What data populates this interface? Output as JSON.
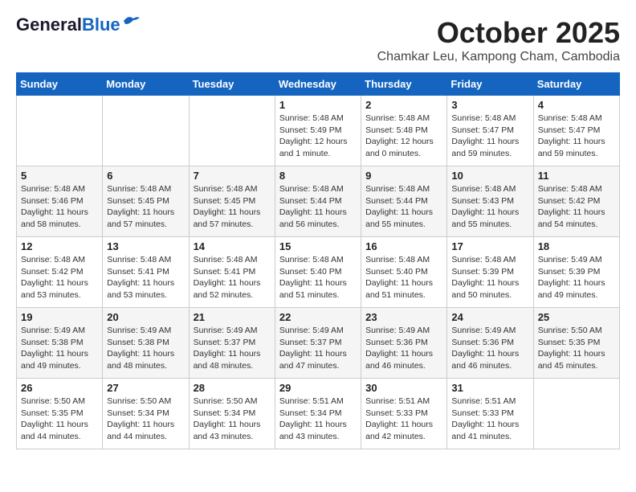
{
  "logo": {
    "line1": "General",
    "line2": "Blue"
  },
  "title": "October 2025",
  "location": "Chamkar Leu, Kampong Cham, Cambodia",
  "days_of_week": [
    "Sunday",
    "Monday",
    "Tuesday",
    "Wednesday",
    "Thursday",
    "Friday",
    "Saturday"
  ],
  "weeks": [
    [
      {
        "day": "",
        "info": ""
      },
      {
        "day": "",
        "info": ""
      },
      {
        "day": "",
        "info": ""
      },
      {
        "day": "1",
        "info": "Sunrise: 5:48 AM\nSunset: 5:49 PM\nDaylight: 12 hours\nand 1 minute."
      },
      {
        "day": "2",
        "info": "Sunrise: 5:48 AM\nSunset: 5:48 PM\nDaylight: 12 hours\nand 0 minutes."
      },
      {
        "day": "3",
        "info": "Sunrise: 5:48 AM\nSunset: 5:47 PM\nDaylight: 11 hours\nand 59 minutes."
      },
      {
        "day": "4",
        "info": "Sunrise: 5:48 AM\nSunset: 5:47 PM\nDaylight: 11 hours\nand 59 minutes."
      }
    ],
    [
      {
        "day": "5",
        "info": "Sunrise: 5:48 AM\nSunset: 5:46 PM\nDaylight: 11 hours\nand 58 minutes."
      },
      {
        "day": "6",
        "info": "Sunrise: 5:48 AM\nSunset: 5:45 PM\nDaylight: 11 hours\nand 57 minutes."
      },
      {
        "day": "7",
        "info": "Sunrise: 5:48 AM\nSunset: 5:45 PM\nDaylight: 11 hours\nand 57 minutes."
      },
      {
        "day": "8",
        "info": "Sunrise: 5:48 AM\nSunset: 5:44 PM\nDaylight: 11 hours\nand 56 minutes."
      },
      {
        "day": "9",
        "info": "Sunrise: 5:48 AM\nSunset: 5:44 PM\nDaylight: 11 hours\nand 55 minutes."
      },
      {
        "day": "10",
        "info": "Sunrise: 5:48 AM\nSunset: 5:43 PM\nDaylight: 11 hours\nand 55 minutes."
      },
      {
        "day": "11",
        "info": "Sunrise: 5:48 AM\nSunset: 5:42 PM\nDaylight: 11 hours\nand 54 minutes."
      }
    ],
    [
      {
        "day": "12",
        "info": "Sunrise: 5:48 AM\nSunset: 5:42 PM\nDaylight: 11 hours\nand 53 minutes."
      },
      {
        "day": "13",
        "info": "Sunrise: 5:48 AM\nSunset: 5:41 PM\nDaylight: 11 hours\nand 53 minutes."
      },
      {
        "day": "14",
        "info": "Sunrise: 5:48 AM\nSunset: 5:41 PM\nDaylight: 11 hours\nand 52 minutes."
      },
      {
        "day": "15",
        "info": "Sunrise: 5:48 AM\nSunset: 5:40 PM\nDaylight: 11 hours\nand 51 minutes."
      },
      {
        "day": "16",
        "info": "Sunrise: 5:48 AM\nSunset: 5:40 PM\nDaylight: 11 hours\nand 51 minutes."
      },
      {
        "day": "17",
        "info": "Sunrise: 5:48 AM\nSunset: 5:39 PM\nDaylight: 11 hours\nand 50 minutes."
      },
      {
        "day": "18",
        "info": "Sunrise: 5:49 AM\nSunset: 5:39 PM\nDaylight: 11 hours\nand 49 minutes."
      }
    ],
    [
      {
        "day": "19",
        "info": "Sunrise: 5:49 AM\nSunset: 5:38 PM\nDaylight: 11 hours\nand 49 minutes."
      },
      {
        "day": "20",
        "info": "Sunrise: 5:49 AM\nSunset: 5:38 PM\nDaylight: 11 hours\nand 48 minutes."
      },
      {
        "day": "21",
        "info": "Sunrise: 5:49 AM\nSunset: 5:37 PM\nDaylight: 11 hours\nand 48 minutes."
      },
      {
        "day": "22",
        "info": "Sunrise: 5:49 AM\nSunset: 5:37 PM\nDaylight: 11 hours\nand 47 minutes."
      },
      {
        "day": "23",
        "info": "Sunrise: 5:49 AM\nSunset: 5:36 PM\nDaylight: 11 hours\nand 46 minutes."
      },
      {
        "day": "24",
        "info": "Sunrise: 5:49 AM\nSunset: 5:36 PM\nDaylight: 11 hours\nand 46 minutes."
      },
      {
        "day": "25",
        "info": "Sunrise: 5:50 AM\nSunset: 5:35 PM\nDaylight: 11 hours\nand 45 minutes."
      }
    ],
    [
      {
        "day": "26",
        "info": "Sunrise: 5:50 AM\nSunset: 5:35 PM\nDaylight: 11 hours\nand 44 minutes."
      },
      {
        "day": "27",
        "info": "Sunrise: 5:50 AM\nSunset: 5:34 PM\nDaylight: 11 hours\nand 44 minutes."
      },
      {
        "day": "28",
        "info": "Sunrise: 5:50 AM\nSunset: 5:34 PM\nDaylight: 11 hours\nand 43 minutes."
      },
      {
        "day": "29",
        "info": "Sunrise: 5:51 AM\nSunset: 5:34 PM\nDaylight: 11 hours\nand 43 minutes."
      },
      {
        "day": "30",
        "info": "Sunrise: 5:51 AM\nSunset: 5:33 PM\nDaylight: 11 hours\nand 42 minutes."
      },
      {
        "day": "31",
        "info": "Sunrise: 5:51 AM\nSunset: 5:33 PM\nDaylight: 11 hours\nand 41 minutes."
      },
      {
        "day": "",
        "info": ""
      }
    ]
  ]
}
